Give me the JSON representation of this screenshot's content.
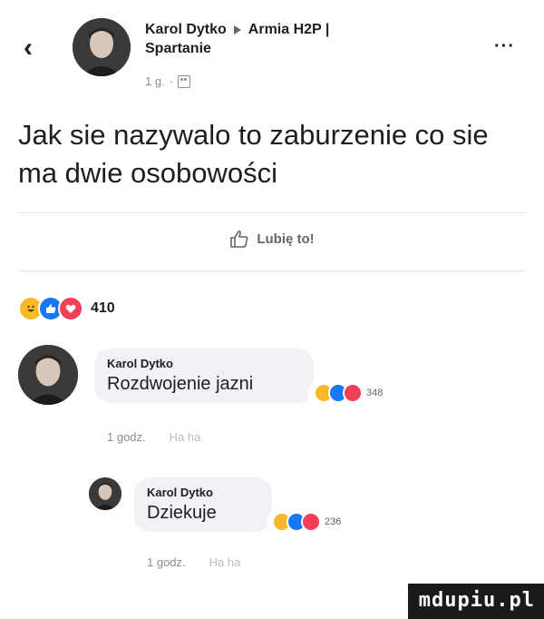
{
  "header": {
    "author": "Karol Dytko",
    "group": "Armia H2P |",
    "group_line2": "Spartanie",
    "time": "1 g.",
    "separator": "·"
  },
  "post": {
    "text": "Jak sie nazywalo to zaburzenie co sie ma dwie osobowości"
  },
  "actions": {
    "like_label": "Lubię to!"
  },
  "reactions": {
    "count": "410"
  },
  "comments": [
    {
      "author": "Karol Dytko",
      "text": "Rozdwojenie jazni",
      "reaction_count": "348",
      "time": "1 godz.",
      "action": "Ha ha"
    },
    {
      "author": "Karol Dytko",
      "text": "Dziekuje",
      "reaction_count": "236",
      "time": "1 godz.",
      "action": "Ha ha"
    }
  ],
  "watermark": "mdupiu.pl",
  "icons": {
    "back": "chevron-left-icon",
    "more": "ellipsis-icon",
    "audience": "group-icon",
    "like": "thumbs-up-icon",
    "reaction_types": [
      "haha",
      "like",
      "love"
    ]
  },
  "colors": {
    "like_blue": "#1877f2",
    "love_red": "#f33e58",
    "haha_yellow": "#f7b928",
    "bubble_grey": "#f0f2f5"
  }
}
